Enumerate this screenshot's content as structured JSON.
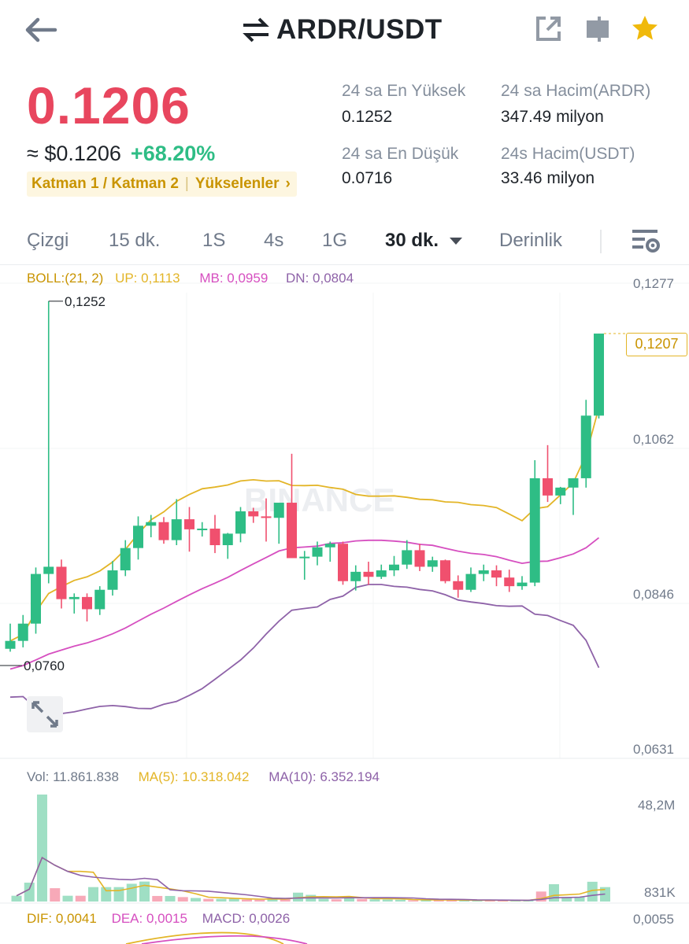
{
  "header": {
    "title": "ARDR/USDT",
    "back_icon": "arrow-left-icon",
    "swap_icon": "swap-arrows-icon",
    "share_icon": "share-icon",
    "layout_icon": "panel-icon",
    "favorite_icon": "star-icon"
  },
  "price": {
    "last": "0.1206",
    "usd": "≈ $0.1206",
    "change": "+68.20%",
    "tags": [
      "Katman 1 / Katman 2",
      "Yükselenler"
    ],
    "tag_arrow": "›"
  },
  "stats": {
    "high_label": "24 sa En Yüksek",
    "high_value": "0.1252",
    "low_label": "24 sa En Düşük",
    "low_value": "0.0716",
    "vol_base_label": "24 sa Hacim(ARDR)",
    "vol_base_value": "347.49 milyon",
    "vol_quote_label": "24s Hacim(USDT)",
    "vol_quote_value": "33.46 milyon"
  },
  "tabs": {
    "items": [
      "Çizgi",
      "15 dk.",
      "1S",
      "4s",
      "1G",
      "30 dk.",
      "Derinlik"
    ],
    "active": "30 dk."
  },
  "indicators": {
    "boll": "BOLL:(21, 2)",
    "up": "UP: 0,1113",
    "mb": "MB: 0,0959",
    "dn": "DN: 0,0804",
    "vol": "Vol: 11.861.838",
    "ma5": "MA(5): 10.318.042",
    "ma10": "MA(10): 6.352.194",
    "dif": "DIF: 0,0041",
    "dea": "DEA: 0,0015",
    "macd": "MACD: 0,0026"
  },
  "axis": {
    "price_ticks": [
      "0,1277",
      "0,1062",
      "0,0846",
      "0,0631"
    ],
    "current_price_tag": "0,1207",
    "high_marker": "0,1252",
    "low_marker": "0,0760",
    "vol_ticks": [
      "48,2M",
      "831K"
    ],
    "macd_tick": "0,0055"
  },
  "watermark": "BINANCE",
  "colors": {
    "up": "#2ebd85",
    "down": "#f0506e",
    "price_red": "#e8465e",
    "boll_up": "#e3b527",
    "boll_mb": "#d64fc0",
    "boll_dn": "#8e62a8",
    "accent": "#f0b90b"
  },
  "chart_data": {
    "type": "candlestick",
    "interval": "30 dk.",
    "ylim": [
      0.0631,
      0.1277
    ],
    "candles": [
      {
        "o": 0.0769,
        "h": 0.0804,
        "l": 0.0765,
        "c": 0.078
      },
      {
        "o": 0.078,
        "h": 0.0816,
        "l": 0.0771,
        "c": 0.0804
      },
      {
        "o": 0.0804,
        "h": 0.0882,
        "l": 0.079,
        "c": 0.0873
      },
      {
        "o": 0.0873,
        "h": 0.1252,
        "l": 0.086,
        "c": 0.0883
      },
      {
        "o": 0.0883,
        "h": 0.0893,
        "l": 0.0825,
        "c": 0.0838
      },
      {
        "o": 0.0838,
        "h": 0.0846,
        "l": 0.0818,
        "c": 0.0841
      },
      {
        "o": 0.0841,
        "h": 0.0846,
        "l": 0.0807,
        "c": 0.0824
      },
      {
        "o": 0.0824,
        "h": 0.0856,
        "l": 0.0816,
        "c": 0.0851
      },
      {
        "o": 0.0851,
        "h": 0.0891,
        "l": 0.0843,
        "c": 0.0878
      },
      {
        "o": 0.0878,
        "h": 0.092,
        "l": 0.087,
        "c": 0.0909
      },
      {
        "o": 0.0909,
        "h": 0.0953,
        "l": 0.0893,
        "c": 0.094
      },
      {
        "o": 0.094,
        "h": 0.0955,
        "l": 0.0924,
        "c": 0.0945
      },
      {
        "o": 0.0945,
        "h": 0.0952,
        "l": 0.0915,
        "c": 0.092
      },
      {
        "o": 0.092,
        "h": 0.0977,
        "l": 0.0913,
        "c": 0.0949
      },
      {
        "o": 0.0949,
        "h": 0.0966,
        "l": 0.0904,
        "c": 0.0935
      },
      {
        "o": 0.0935,
        "h": 0.0945,
        "l": 0.0925,
        "c": 0.0936
      },
      {
        "o": 0.0936,
        "h": 0.0955,
        "l": 0.0902,
        "c": 0.0913
      },
      {
        "o": 0.0913,
        "h": 0.093,
        "l": 0.0894,
        "c": 0.0929
      },
      {
        "o": 0.0929,
        "h": 0.0966,
        "l": 0.0917,
        "c": 0.096
      },
      {
        "o": 0.096,
        "h": 0.0965,
        "l": 0.0944,
        "c": 0.0953
      },
      {
        "o": 0.0953,
        "h": 0.0978,
        "l": 0.0918,
        "c": 0.0951
      },
      {
        "o": 0.0951,
        "h": 0.0959,
        "l": 0.0915,
        "c": 0.0972
      },
      {
        "o": 0.0972,
        "h": 0.104,
        "l": 0.0907,
        "c": 0.0895
      },
      {
        "o": 0.0895,
        "h": 0.0905,
        "l": 0.0865,
        "c": 0.0897
      },
      {
        "o": 0.0897,
        "h": 0.0918,
        "l": 0.0885,
        "c": 0.091
      },
      {
        "o": 0.091,
        "h": 0.0918,
        "l": 0.089,
        "c": 0.0915
      },
      {
        "o": 0.0915,
        "h": 0.0918,
        "l": 0.0858,
        "c": 0.0863
      },
      {
        "o": 0.0863,
        "h": 0.0885,
        "l": 0.085,
        "c": 0.0876
      },
      {
        "o": 0.0876,
        "h": 0.089,
        "l": 0.0858,
        "c": 0.0869
      },
      {
        "o": 0.0869,
        "h": 0.0886,
        "l": 0.0866,
        "c": 0.0878
      },
      {
        "o": 0.0878,
        "h": 0.0898,
        "l": 0.087,
        "c": 0.0886
      },
      {
        "o": 0.0886,
        "h": 0.092,
        "l": 0.088,
        "c": 0.0906
      },
      {
        "o": 0.0906,
        "h": 0.0915,
        "l": 0.0877,
        "c": 0.0883
      },
      {
        "o": 0.0883,
        "h": 0.0897,
        "l": 0.0876,
        "c": 0.0892
      },
      {
        "o": 0.0892,
        "h": 0.0893,
        "l": 0.086,
        "c": 0.0863
      },
      {
        "o": 0.0863,
        "h": 0.0871,
        "l": 0.084,
        "c": 0.0851
      },
      {
        "o": 0.0851,
        "h": 0.0882,
        "l": 0.0848,
        "c": 0.0873
      },
      {
        "o": 0.0873,
        "h": 0.0886,
        "l": 0.0863,
        "c": 0.0878
      },
      {
        "o": 0.0878,
        "h": 0.0885,
        "l": 0.0856,
        "c": 0.0868
      },
      {
        "o": 0.0868,
        "h": 0.0879,
        "l": 0.0848,
        "c": 0.0856
      },
      {
        "o": 0.0856,
        "h": 0.087,
        "l": 0.0851,
        "c": 0.0861
      },
      {
        "o": 0.0861,
        "h": 0.1031,
        "l": 0.0856,
        "c": 0.1006
      },
      {
        "o": 0.1006,
        "h": 0.1052,
        "l": 0.0973,
        "c": 0.0982
      },
      {
        "o": 0.0982,
        "h": 0.0994,
        "l": 0.097,
        "c": 0.0993
      },
      {
        "o": 0.0993,
        "h": 0.1006,
        "l": 0.0955,
        "c": 0.1006
      },
      {
        "o": 0.1006,
        "h": 0.1115,
        "l": 0.0993,
        "c": 0.1093
      },
      {
        "o": 0.1093,
        "h": 0.1207,
        "l": 0.1089,
        "c": 0.1207
      }
    ],
    "volume": {
      "ylim": [
        0,
        48.2
      ],
      "values": [
        2.6,
        8.5,
        48.2,
        6.0,
        2.6,
        2.6,
        6.5,
        6.5,
        6.5,
        8.0,
        9.0,
        2.5,
        2.5,
        2.0,
        1.6,
        1.2,
        1.2,
        1.2,
        0.9,
        0.8,
        1.5,
        1.3,
        4.0,
        3.0,
        1.2,
        1.0,
        2.2,
        1.2,
        1.0,
        0.9,
        0.8,
        0.6,
        0.6,
        0.8,
        0.7,
        0.5,
        0.5,
        0.6,
        0.5,
        0.5,
        0.5,
        4.5,
        7.8,
        2.0,
        2.0,
        8.9,
        6.5
      ],
      "ma5": "MA(5): 10.318.042",
      "ma10": "MA(10): 6.352.194"
    }
  }
}
